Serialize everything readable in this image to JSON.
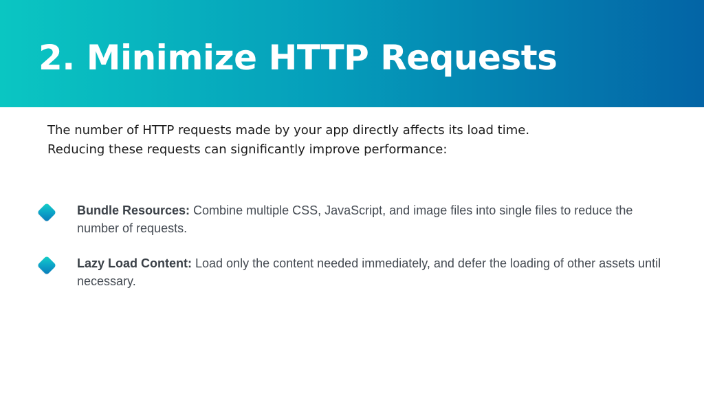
{
  "slide": {
    "title": "2. Minimize HTTP Requests",
    "intro": [
      "The number of HTTP requests made by your app directly affects its load time.",
      "Reducing these requests can significantly improve performance:"
    ],
    "bullets": [
      {
        "icon": "diamond-bullet-icon",
        "lead": "Bundle Resources:",
        "text": " Combine multiple CSS, JavaScript, and image files into single files to reduce the number of requests."
      },
      {
        "icon": "diamond-bullet-icon",
        "lead": "Lazy Load Content:",
        "text": " Load only the content needed immediately, and defer the loading of other assets until necessary."
      }
    ]
  },
  "colors": {
    "header_gradient_start": "#0ac6c2",
    "header_gradient_end": "#0364a6",
    "title_text": "#ffffff",
    "body_text": "#444a52"
  }
}
